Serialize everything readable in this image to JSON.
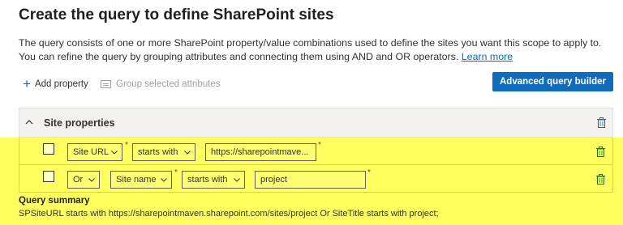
{
  "page": {
    "title": "Create the query to define SharePoint sites",
    "description": "The query consists of one or more SharePoint property/value combinations used to define the sites you want this scope to apply to. You can refine the query by grouping attributes and connecting them using AND and OR operators.",
    "learn_more": "Learn more"
  },
  "toolbar": {
    "add_property": "Add property",
    "group_selected": "Group selected attributes",
    "advanced_query_builder": "Advanced query builder",
    "add_icon": "plus-icon",
    "group_icon": "group-icon"
  },
  "group": {
    "title": "Site properties",
    "collapse_icon": "chevron-up-icon",
    "delete_icon": "trash-icon"
  },
  "rows": [
    {
      "property": "Site URL",
      "operator": "starts with",
      "value": "https://sharepointmave...",
      "required_mark": "*"
    },
    {
      "connector": "Or",
      "property": "Site name",
      "operator": "starts with",
      "value": "project",
      "required_mark": "*"
    }
  ],
  "summary": {
    "label": "Query summary",
    "text": "SPSiteURL starts with https://sharepointmaven.sharepoint.com/sites/project Or SiteTitle starts with project;"
  },
  "colors": {
    "accent": "#0f6cbd",
    "highlight": "#ffff60",
    "required": "#a4262c"
  }
}
